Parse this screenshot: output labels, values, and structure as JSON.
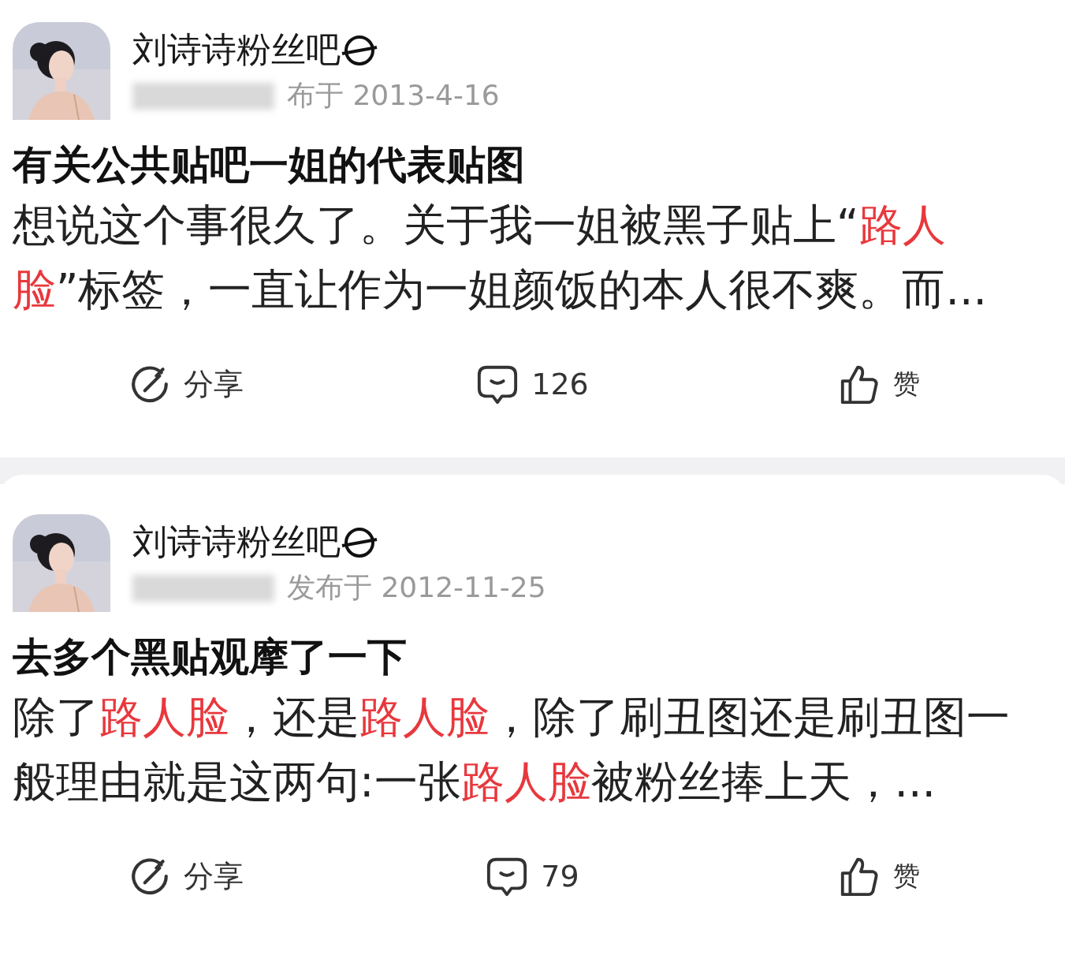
{
  "posts": [
    {
      "forum": "刘诗诗粉丝吧",
      "date": "布于 2013-4-16",
      "title": "有关公共贴吧一姐的代表贴图",
      "excerpt": [
        {
          "text": "想说这个事很久了。关于我一姐被黑子贴上“",
          "highlight": false
        },
        {
          "text": "路人脸",
          "highlight": true
        },
        {
          "text": "”标签，一直让作为一姐颜饭的本人很不爽。而...",
          "highlight": false
        }
      ],
      "actions": [
        {
          "kind": "share",
          "label": "分享"
        },
        {
          "kind": "comment",
          "label": "126"
        },
        {
          "kind": "like",
          "label": "赞"
        }
      ]
    },
    {
      "forum": "刘诗诗粉丝吧",
      "date": "发布于 2012-11-25",
      "title": "去多个黑贴观摩了一下",
      "excerpt": [
        {
          "text": "除了",
          "highlight": false
        },
        {
          "text": "路人脸",
          "highlight": true
        },
        {
          "text": "，还是",
          "highlight": false
        },
        {
          "text": "路人脸",
          "highlight": true
        },
        {
          "text": "，除了刷丑图还是刷丑图一般理由就是这两句:一张",
          "highlight": false
        },
        {
          "text": "路人脸",
          "highlight": true
        },
        {
          "text": "被粉丝捧上天，...",
          "highlight": false
        }
      ],
      "actions": [
        {
          "kind": "share",
          "label": "分享"
        },
        {
          "kind": "comment",
          "label": "79"
        },
        {
          "kind": "like",
          "label": "赞"
        }
      ]
    }
  ]
}
